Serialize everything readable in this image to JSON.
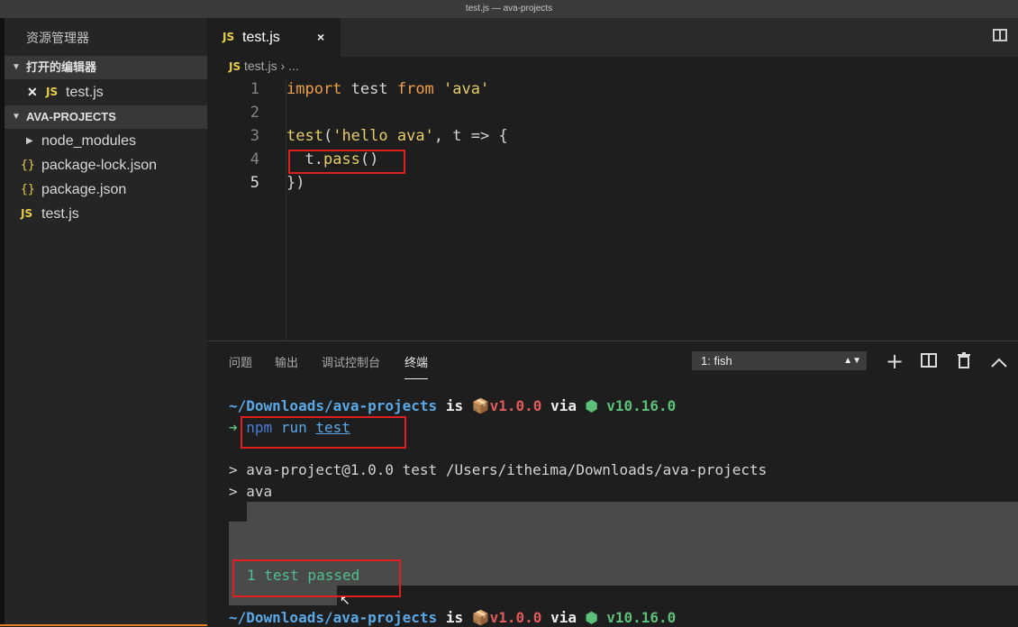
{
  "window": {
    "title": "test.js — ava-projects"
  },
  "sidebar": {
    "title": "资源管理器",
    "open_editors": {
      "label": "打开的编辑器",
      "items": [
        {
          "badge": "JS",
          "name": "test.js"
        }
      ]
    },
    "project": {
      "label": "AVA-PROJECTS",
      "items": [
        {
          "type": "folder",
          "name": "node_modules"
        },
        {
          "type": "json",
          "badge": "{}",
          "name": "package-lock.json"
        },
        {
          "type": "json",
          "badge": "{}",
          "name": "package.json"
        },
        {
          "type": "js",
          "badge": "JS",
          "name": "test.js"
        }
      ]
    }
  },
  "editor": {
    "tab": {
      "badge": "JS",
      "name": "test.js",
      "close": "×"
    },
    "breadcrumb": {
      "badge": "JS",
      "file": "test.js",
      "sep": "›",
      "more": "..."
    },
    "lines": [
      {
        "n": "1",
        "parts": [
          "import",
          " test ",
          "from",
          " ",
          "'ava'"
        ]
      },
      {
        "n": "2",
        "parts": []
      },
      {
        "n": "3",
        "parts": [
          "test",
          "(",
          "'hello ava'",
          ", t => {"
        ]
      },
      {
        "n": "4",
        "parts": [
          "  t.",
          "pass",
          "()"
        ]
      },
      {
        "n": "5",
        "parts": [
          "})"
        ]
      }
    ]
  },
  "panel": {
    "tabs": [
      "问题",
      "输出",
      "调试控制台",
      "终端"
    ],
    "active_tab": "终端",
    "terminal_select": "1: fish",
    "terminal": {
      "prompt_path": "~/Downloads/ava-projects",
      "is": " is ",
      "package_icon": "📦",
      "pkg_version": "v1.0.0",
      "via": " via ",
      "node_icon": "⬢",
      "node_version": "v10.16.0",
      "arrow": "➜",
      "cmd": [
        "npm",
        "run",
        "test"
      ],
      "output": [
        "> ava-project@1.0.0 test /Users/itheima/Downloads/ava-projects",
        "> ava"
      ],
      "result": "1 test passed"
    }
  },
  "colors": {
    "accent_red_box": "#e02020",
    "path_blue": "#5aa9e6",
    "js_yellow": "#e6d04a"
  }
}
